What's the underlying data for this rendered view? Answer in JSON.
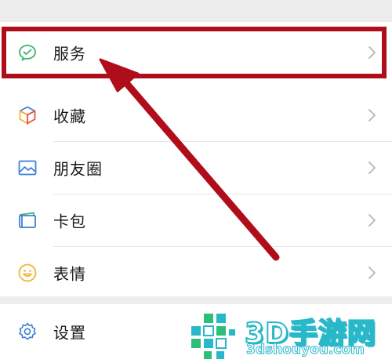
{
  "menu": {
    "items": [
      {
        "label": "服务",
        "icon": "service-chat-icon"
      },
      {
        "label": "收藏",
        "icon": "favorites-cube-icon"
      },
      {
        "label": "朋友圈",
        "icon": "moments-picture-icon"
      },
      {
        "label": "卡包",
        "icon": "card-wallet-icon"
      },
      {
        "label": "表情",
        "icon": "sticker-smiley-icon"
      }
    ]
  },
  "settings": {
    "label": "设置",
    "icon": "gear-icon"
  },
  "watermark": {
    "title": "3D手游网",
    "url": "3dshouyou.com"
  },
  "colors": {
    "highlight": "#b00d1b",
    "icon_green": "#3fb56b",
    "icon_blue": "#3d7fd6",
    "icon_yellow": "#f2b531",
    "watermark": "#29b8c9"
  }
}
